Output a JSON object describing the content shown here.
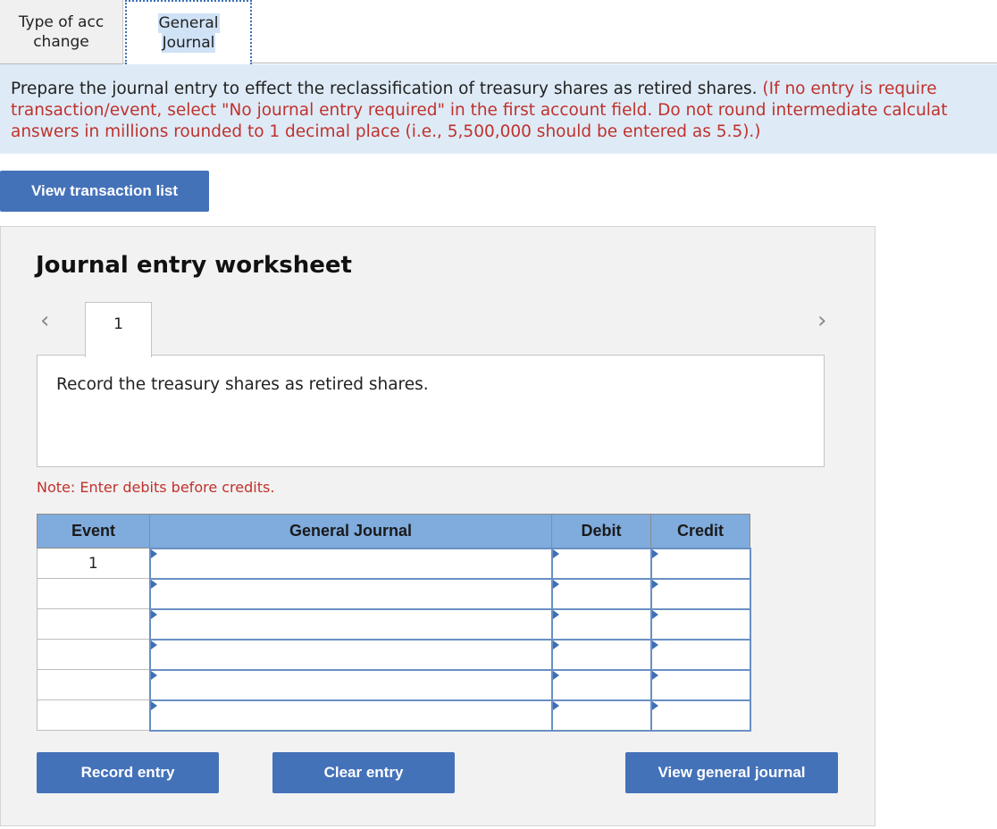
{
  "tabs": [
    {
      "line1": "Type of acc",
      "line2": "change"
    },
    {
      "line1": "General",
      "line2": "Journal"
    }
  ],
  "instructions": {
    "main": "Prepare the journal entry to effect the reclassification of treasury shares as retired shares.",
    "red_line1": " (If no entry is require",
    "red_line2": "transaction/event, select \"No journal entry required\" in the first account field. Do not round intermediate calculat",
    "red_line3": "answers in millions rounded to 1 decimal place (i.e., 5,500,000 should be entered as 5.5).)"
  },
  "view_transaction_list": "View transaction list",
  "worksheet": {
    "title": "Journal entry worksheet",
    "prev_icon": "‹",
    "next_icon": "›",
    "entry_tab": "1",
    "description": "Record the treasury shares as retired shares.",
    "note": "Note: Enter debits before credits.",
    "columns": {
      "event": "Event",
      "general_journal": "General Journal",
      "debit": "Debit",
      "credit": "Credit"
    },
    "rows": [
      {
        "event": "1"
      },
      {
        "event": ""
      },
      {
        "event": ""
      },
      {
        "event": ""
      },
      {
        "event": ""
      },
      {
        "event": ""
      }
    ],
    "buttons": {
      "record": "Record entry",
      "clear": "Clear entry",
      "view_general_journal": "View general journal"
    }
  }
}
